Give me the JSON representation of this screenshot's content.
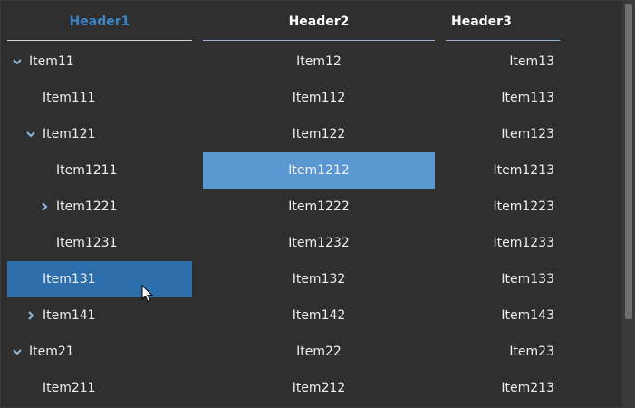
{
  "headers": [
    "Header1",
    "Header2",
    "Header3"
  ],
  "rows": [
    {
      "c1": "Item11",
      "c2": "Item12",
      "c3": "Item13",
      "indent": 0,
      "toggle": "expanded"
    },
    {
      "c1": "Item111",
      "c2": "Item112",
      "c3": "Item113",
      "indent": 1,
      "toggle": "none"
    },
    {
      "c1": "Item121",
      "c2": "Item122",
      "c3": "Item123",
      "indent": 1,
      "toggle": "expanded"
    },
    {
      "c1": "Item1211",
      "c2": "Item1212",
      "c3": "Item1213",
      "indent": 2,
      "toggle": "none",
      "selected_col": 2
    },
    {
      "c1": "Item1221",
      "c2": "Item1222",
      "c3": "Item1223",
      "indent": 2,
      "toggle": "collapsed"
    },
    {
      "c1": "Item1231",
      "c2": "Item1232",
      "c3": "Item1233",
      "indent": 2,
      "toggle": "none"
    },
    {
      "c1": "Item131",
      "c2": "Item132",
      "c3": "Item133",
      "indent": 1,
      "toggle": "none",
      "selected_col": 1
    },
    {
      "c1": "Item141",
      "c2": "Item142",
      "c3": "Item143",
      "indent": 1,
      "toggle": "collapsed"
    },
    {
      "c1": "Item21",
      "c2": "Item22",
      "c3": "Item23",
      "indent": 0,
      "toggle": "expanded"
    },
    {
      "c1": "Item211",
      "c2": "Item212",
      "c3": "Item213",
      "indent": 1,
      "toggle": "none"
    }
  ],
  "colors": {
    "background": "#2f2f2f",
    "selected_primary": "#2d6fad",
    "selected_secondary": "#5b98d3",
    "header1_text": "#3f87c9"
  }
}
